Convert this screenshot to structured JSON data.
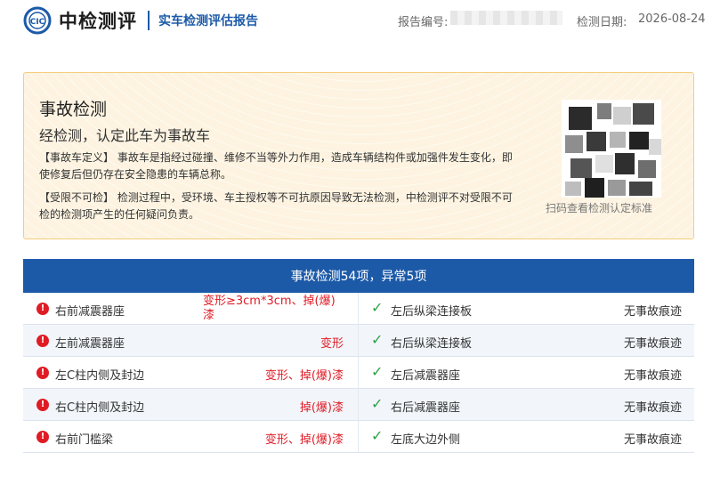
{
  "header": {
    "brand": "中检测评",
    "subtitle": "实车检测评估报告",
    "report_no_label": "报告编号:",
    "date_label": "检测日期:",
    "date_value": "2026-08-24"
  },
  "summary": {
    "title": "事故检测",
    "verdict": "经检测，认定此车为事故车",
    "definition": "【事故车定义】  事故车是指经过碰撞、维修不当等外力作用，造成车辆结构件或加强件发生变化，即使修复后但仍存在安全隐患的车辆总称。",
    "limitation": "【受限不可检】  检测过程中，受环境、车主授权等不可抗原因导致无法检测，中检测评不对受限不可检的检测项产生的任何疑问负责。",
    "qr_caption": "扫码查看检测认定标准"
  },
  "results": {
    "heading": "事故检测54项，异常5项",
    "rows": [
      {
        "left_name": "右前减震器座",
        "left_status": "变形≥3cm*3cm、掉(爆)漆",
        "right_name": "左后纵梁连接板",
        "right_status": "无事故痕迹"
      },
      {
        "left_name": "左前减震器座",
        "left_status": "变形",
        "right_name": "右后纵梁连接板",
        "right_status": "无事故痕迹"
      },
      {
        "left_name": "左C柱内侧及封边",
        "left_status": "变形、掉(爆)漆",
        "right_name": "左后减震器座",
        "right_status": "无事故痕迹"
      },
      {
        "left_name": "右C柱内侧及封边",
        "left_status": "掉(爆)漆",
        "right_name": "右后减震器座",
        "right_status": "无事故痕迹"
      },
      {
        "left_name": "右前门槛梁",
        "left_status": "变形、掉(爆)漆",
        "right_name": "左底大边外侧",
        "right_status": "无事故痕迹"
      }
    ]
  },
  "icons": {
    "logo": "logo-icon",
    "warning": "warning-icon",
    "check": "check-icon",
    "qr": "qr-code-icon"
  },
  "colors": {
    "brand_blue": "#1c5aa8",
    "alert_red": "#e01b24",
    "ok_green": "#2aa245",
    "summary_bg": "#fdf3e0"
  }
}
